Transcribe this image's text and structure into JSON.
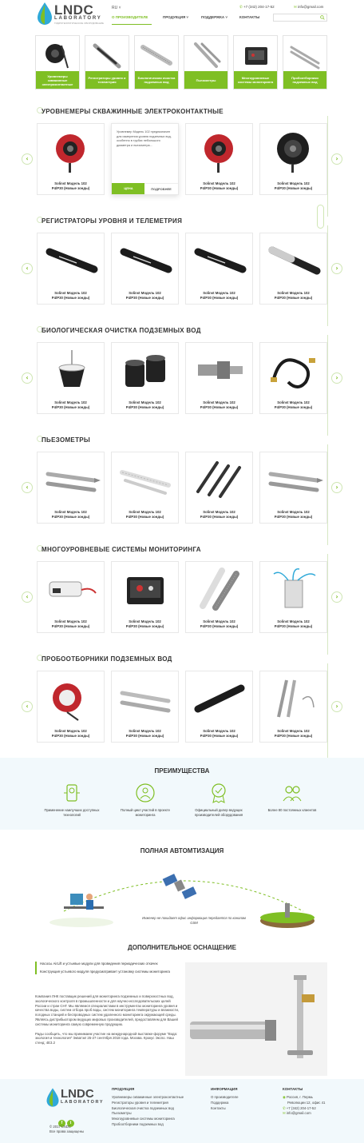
{
  "header": {
    "logo_text": "LNDC",
    "logo_sub": "LABORATORY",
    "logo_tag": "ГИДРОГЕОЛОГИЧЕСКОЕ ОБОРУДОВАНИЕ",
    "lang": "RU ˅",
    "nav": [
      "О ПРОИЗВОДИТЕЛЕ",
      "ПРОДУКЦИЯ ˅",
      "ПОДДЕРЖКА ˅",
      "КОНТАКТЫ"
    ],
    "phone": "+7 (342) 204-17-52",
    "email": "info@gmail.com",
    "search_placeholder": ""
  },
  "categories": [
    "Уровнемеры скважинные электроконтактные",
    "Регистраторы уровня и телеметрия",
    "Биологическая очистка подземных вод",
    "Пьезометры",
    "Многоуровневые системы мониторинга",
    "Пробоотборники подземных вод"
  ],
  "product_name_line1": "Solinst Модель 102",
  "product_name_line2": "P4/P30 (Новые зонды)",
  "sections": [
    {
      "title": "УРОВНЕМЕРЫ СКВАЖИННЫЕ ЭЛЕКТРОКОНТАКТНЫЕ"
    },
    {
      "title": "РЕГИСТРАТОРЫ УРОВНЯ И ТЕЛЕМЕТРИЯ"
    },
    {
      "title": "БИОЛОГИЧЕСКАЯ ОЧИСТКА ПОДЗЕМНЫХ ВОД"
    },
    {
      "title": "ПЬЕЗОМЕТРЫ"
    },
    {
      "title": "МНОГОУРОВНЕВЫЕ СИСТЕМЫ МОНИТОРИНГА"
    },
    {
      "title": "ПРОБООТБОРНИКИ ПОДЗЕМНЫХ ВОД"
    }
  ],
  "hover_card": {
    "desc": "Уровнемер Модель 102 предназначен для измерения уровня подземных вод, особенно в трубах небольшого диаметра и пьезометра...",
    "price_btn": "ЦЕНА",
    "more_btn": "ПОДРОБНЕЕ"
  },
  "advantages": {
    "title": "ПРЕИМУЩЕСТВА",
    "items": [
      "Применение наилучших доступных технологий",
      "Полный цикл участий в проекте мониторинга",
      "Официальный дилер ведущих производителей оборудования",
      "Более 80 постоянных клиентов"
    ]
  },
  "automation": {
    "title": "ПОЛНАЯ АВТОМТИЗАЦИЯ",
    "caption": "Инженер не покидает офис информация передается по каналам GSM"
  },
  "equipment": {
    "title": "ДОПОЛНИТЕЛЬНОЕ ОСНАЩЕНИЕ",
    "note1": "Насосы AirLift и устьевые модули для проведения периодических откачек",
    "note2": "Конструкция устьевого модуля предусматривает установку системы мониторинга",
    "text1": "Компания ЛНК поставщик решений для мониторинга подземных и поверхностных вод, экологического контроля в промышленности и для научно-исследовательских целей России и стран СНГ. Мы являемся специалистами в инструментах мониторинга уровня и качества воды, систем отбора проб воды, систем мониторинга температуры и влажности, погодных станций и беспроводных систем удаленного мониторинга окружающей среды. Являясь дистрибьютором ведущих мировых производителей, предоставляем для Вашей системы мониторинга самую современную продукцию.",
    "text2": "Рады сообщить, что мы принимаем участие на международной выставке-форуме \"Вода: экология и технология\" Экватэк! 25-27 сентября 2018 года. Москва. Крокус Экспо. Наш стенд: 4E3.2"
  },
  "footer": {
    "copyright": "© 2017 LNDC",
    "rights": "Все права защищены",
    "products_head": "ПРОДУКЦИЯ",
    "products": [
      "Уровнемеры скважинные электроконтактные",
      "Регистраторы уровня и телеметрия",
      "Биологическая очистка подземных вод",
      "Пьезометры",
      "Многоуровневые системы мониторинга",
      "Пробоотборники подземных вод"
    ],
    "info_head": "ИНФОРМАЦИЯ",
    "info": [
      "О производителе",
      "Поддержка",
      "Контакты"
    ],
    "contacts_head": "КОНТАКТЫ",
    "address1": "Россия, г. Пермь",
    "address2": "Революции 12, офис 41",
    "phone": "+7 (342) 204-17-52",
    "email": "info@gmail.com"
  },
  "colors": {
    "accent": "#7fbf24",
    "light_bg": "#f2f9fc",
    "reel_red": "#c0272d"
  }
}
